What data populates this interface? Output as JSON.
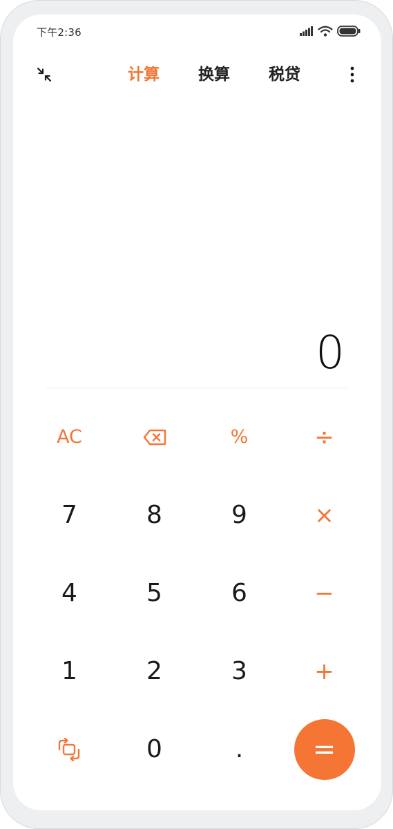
{
  "status_bar": {
    "time": "下午2:36",
    "icons": [
      "signal-icon",
      "wifi-icon",
      "battery-icon"
    ]
  },
  "header": {
    "icons": [
      "collapse-icon",
      "more-vertical-icon"
    ],
    "tabs": [
      {
        "label": "计算",
        "active": true
      },
      {
        "label": "换算",
        "active": false
      },
      {
        "label": "税贷",
        "active": false
      }
    ]
  },
  "display": {
    "value": "0"
  },
  "keypad": {
    "row1": [
      "AC",
      "backspace-icon",
      "%",
      "÷"
    ],
    "row2": [
      "7",
      "8",
      "9",
      "×"
    ],
    "row3": [
      "4",
      "5",
      "6",
      "−"
    ],
    "row4": [
      "1",
      "2",
      "3",
      "+"
    ],
    "row5": [
      "switch-mode-icon",
      "0",
      ".",
      "="
    ]
  },
  "colors": {
    "accent": "#f47534",
    "text": "#1a1a1a",
    "background": "#ffffff"
  }
}
